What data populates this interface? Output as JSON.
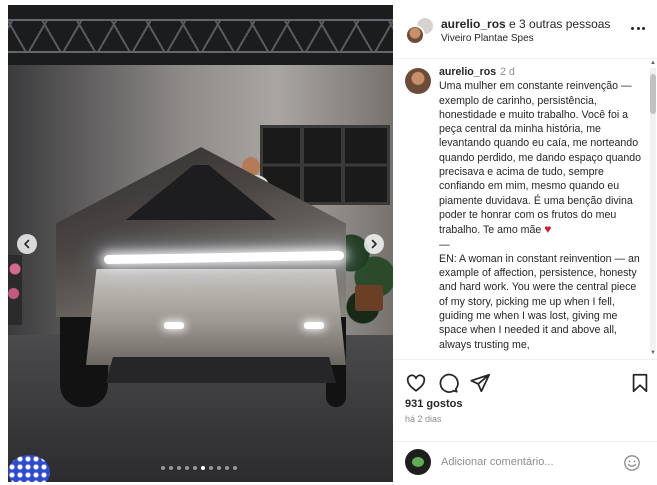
{
  "header": {
    "username": "aurelio_ros",
    "title_suffix": " e 3 outras pessoas",
    "location": "Viveiro Plantae Spes",
    "more_icon": "more-horizontal-icon"
  },
  "carousel": {
    "total_slides": 10,
    "active_index": 5,
    "prev_icon": "chevron-left-icon",
    "next_icon": "chevron-right-icon"
  },
  "caption": {
    "username": "aurelio_ros",
    "time": "2 d",
    "text": "Uma mulher em constante reinvenção — exemplo de carinho, persistência, honestidade e muito trabalho. Você foi a peça central da minha história, me levantando quando eu caía, me norteando quando perdido, me dando espaço quando precisava e acima de tudo, sempre confiando em mim, mesmo quando eu piamente duvidava. É uma benção divina poder te honrar com os frutos do meu trabalho. Te amo mãe",
    "heart": "♥",
    "separator": "—",
    "text_en": "EN: A woman in constant reinvention — an example of affection, persistence, honesty and hard work. You were the central piece of my story, picking me up when I fell, guiding me when I was lost, giving me space when I needed it and above all, always trusting me,"
  },
  "actions": {
    "like_icon": "heart-icon",
    "comment_icon": "comment-icon",
    "share_icon": "share-icon",
    "save_icon": "bookmark-icon",
    "likes": "931 gostos",
    "time_ago": "há 2 dias"
  },
  "comment_box": {
    "placeholder": "Adicionar comentário...",
    "emoji_icon": "emoji-icon"
  },
  "colors": {
    "text": "#262626",
    "muted": "#8e8e8e",
    "heart_red": "#d11a2a",
    "border": "#efefef"
  }
}
